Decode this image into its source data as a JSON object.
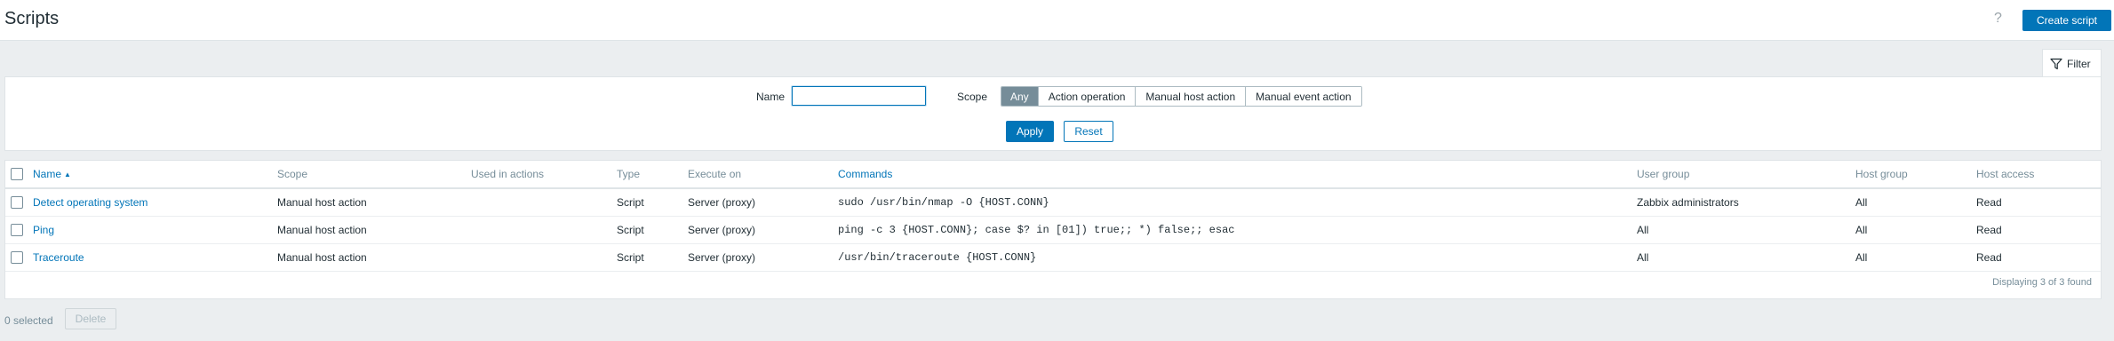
{
  "header": {
    "title": "Scripts",
    "help_label": "?",
    "create_button": "Create script"
  },
  "filter": {
    "tab_label": "Filter",
    "name_label": "Name",
    "name_value": "",
    "scope_label": "Scope",
    "scope_options": [
      "Any",
      "Action operation",
      "Manual host action",
      "Manual event action"
    ],
    "scope_selected": "Any",
    "apply_label": "Apply",
    "reset_label": "Reset"
  },
  "table": {
    "columns": {
      "name": "Name",
      "scope": "Scope",
      "used_in_actions": "Used in actions",
      "type": "Type",
      "execute_on": "Execute on",
      "commands": "Commands",
      "user_group": "User group",
      "host_group": "Host group",
      "host_access": "Host access"
    },
    "sort_indicator": "▲",
    "rows": [
      {
        "name": "Detect operating system",
        "scope": "Manual host action",
        "used_in_actions": "",
        "type": "Script",
        "execute_on": "Server (proxy)",
        "commands": "sudo /usr/bin/nmap -O {HOST.CONN}",
        "user_group": "Zabbix administrators",
        "host_group": "All",
        "host_access": "Read"
      },
      {
        "name": "Ping",
        "scope": "Manual host action",
        "used_in_actions": "",
        "type": "Script",
        "execute_on": "Server (proxy)",
        "commands": "ping -c 3 {HOST.CONN}; case $? in [01]) true;; *) false;; esac",
        "user_group": "All",
        "host_group": "All",
        "host_access": "Read"
      },
      {
        "name": "Traceroute",
        "scope": "Manual host action",
        "used_in_actions": "",
        "type": "Script",
        "execute_on": "Server (proxy)",
        "commands": "/usr/bin/traceroute {HOST.CONN}",
        "user_group": "All",
        "host_group": "All",
        "host_access": "Read"
      }
    ],
    "paging_text": "Displaying 3 of 3 found"
  },
  "footer": {
    "selected_text": "0 selected",
    "delete_label": "Delete"
  },
  "colors": {
    "accent": "#0275b8",
    "background": "#ebeef0",
    "selected_segment": "#768d99"
  }
}
